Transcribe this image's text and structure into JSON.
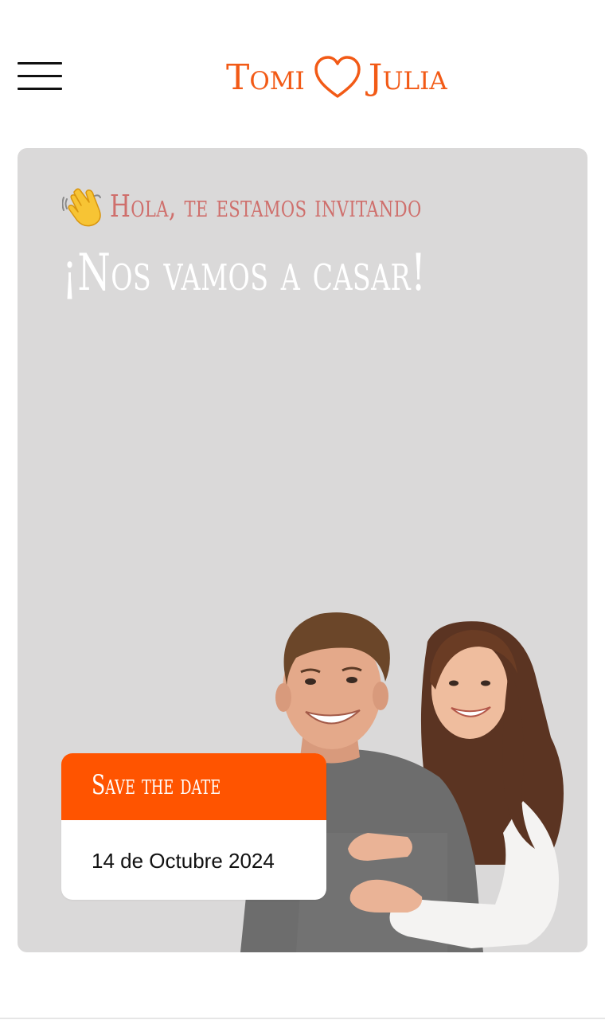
{
  "header": {
    "brand_left": "Tomi",
    "brand_right": "Julia",
    "heart_icon": "heart-outline-icon",
    "menu_icon": "hamburger-menu-icon"
  },
  "hero": {
    "greeting_icon": "waving-hand-icon",
    "greeting": "Hola, te estamos invitando",
    "headline": "¡Nos vamos a casar!"
  },
  "save_the_date": {
    "title": "Save the date",
    "date": "14 de Octubre 2024"
  },
  "colors": {
    "brand_orange": "#f25a16",
    "card_orange": "#ff5400",
    "greeting_rose": "#cf6f6c",
    "hero_bg": "#dad9d9"
  }
}
